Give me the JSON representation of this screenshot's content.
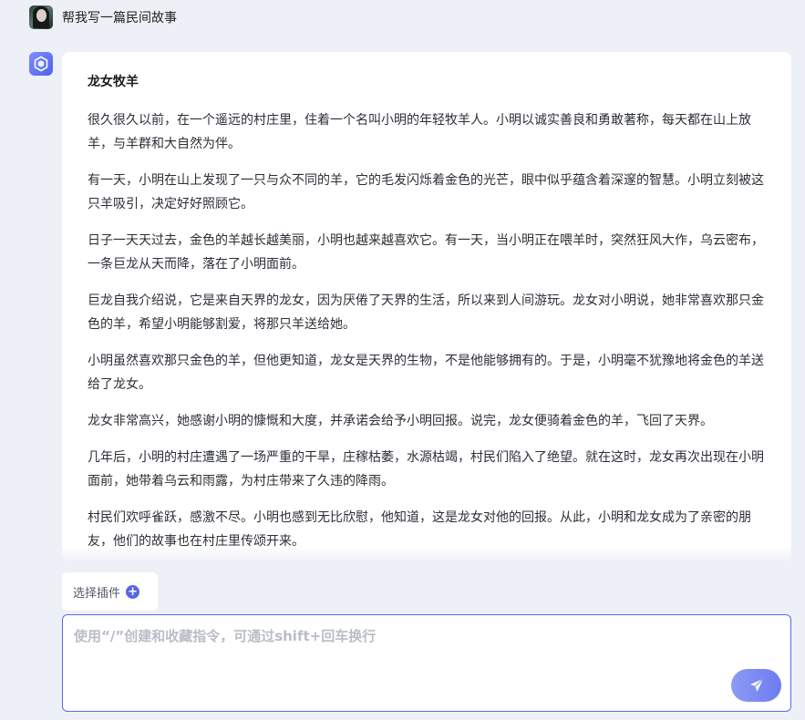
{
  "user_message": {
    "text": "帮我写一篇民间故事"
  },
  "answer": {
    "title": "龙女牧羊",
    "paragraphs": [
      "很久很久以前，在一个遥远的村庄里，住着一个名叫小明的年轻牧羊人。小明以诚实善良和勇敢著称，每天都在山上放羊，与羊群和大自然为伴。",
      "有一天，小明在山上发现了一只与众不同的羊，它的毛发闪烁着金色的光芒，眼中似乎蕴含着深邃的智慧。小明立刻被这只羊吸引，决定好好照顾它。",
      "日子一天天过去，金色的羊越长越美丽，小明也越来越喜欢它。有一天，当小明正在喂羊时，突然狂风大作，乌云密布，一条巨龙从天而降，落在了小明面前。",
      "巨龙自我介绍说，它是来自天界的龙女，因为厌倦了天界的生活，所以来到人间游玩。龙女对小明说，她非常喜欢那只金色的羊，希望小明能够割爱，将那只羊送给她。",
      "小明虽然喜欢那只金色的羊，但他更知道，龙女是天界的生物，不是他能够拥有的。于是，小明毫不犹豫地将金色的羊送给了龙女。",
      "龙女非常高兴，她感谢小明的慷慨和大度，并承诺会给予小明回报。说完，龙女便骑着金色的羊，飞回了天界。",
      "几年后，小明的村庄遭遇了一场严重的干旱，庄稼枯萎，水源枯竭，村民们陷入了绝望。就在这时，龙女再次出现在小明面前，她带着乌云和雨露，为村庄带来了久违的降雨。",
      "村民们欢呼雀跃，感激不尽。小明也感到无比欣慰，他知道，这是龙女对他的回报。从此，小明和龙女成为了亲密的朋友，他们的故事也在村庄里传颂开来。"
    ]
  },
  "plugin": {
    "label": "选择插件",
    "icon": "plus-circle-icon"
  },
  "input": {
    "placeholder": "使用“/”创建和收藏指令，可通过shift+回车换行",
    "value": ""
  },
  "send": {
    "icon": "paper-plane-icon"
  },
  "colors": {
    "accent": "#5a6be6",
    "background": "#eef0f7",
    "send_gradient_start": "#8e9af5",
    "send_gradient_end": "#6b7cf0"
  }
}
